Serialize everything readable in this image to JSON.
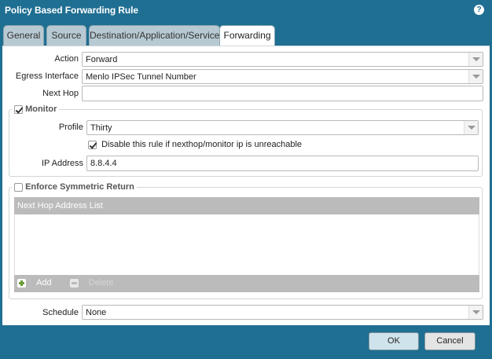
{
  "dialog": {
    "title": "Policy Based Forwarding Rule",
    "help_icon": "?"
  },
  "tabs": [
    {
      "label": "General"
    },
    {
      "label": "Source"
    },
    {
      "label": "Destination/Application/Service"
    },
    {
      "label": "Forwarding",
      "active": true
    }
  ],
  "form": {
    "action_label": "Action",
    "action_value": "Forward",
    "egress_label": "Egress Interface",
    "egress_value": "Menlo IPSec Tunnel Number",
    "nexthop_label": "Next Hop",
    "nexthop_value": ""
  },
  "monitor": {
    "legend": "Monitor",
    "checked": true,
    "profile_label": "Profile",
    "profile_value": "Thirty",
    "disable_label": "Disable this rule if nexthop/monitor ip is unreachable",
    "disable_checked": true,
    "ip_label": "IP Address",
    "ip_value": "8.8.4.4"
  },
  "symmetric": {
    "legend": "Enforce Symmetric Return",
    "checked": false,
    "list_header": "Next Hop Address List",
    "add_label": "Add",
    "delete_label": "Delete"
  },
  "schedule": {
    "label": "Schedule",
    "value": "None"
  },
  "buttons": {
    "ok": "OK",
    "cancel": "Cancel"
  }
}
